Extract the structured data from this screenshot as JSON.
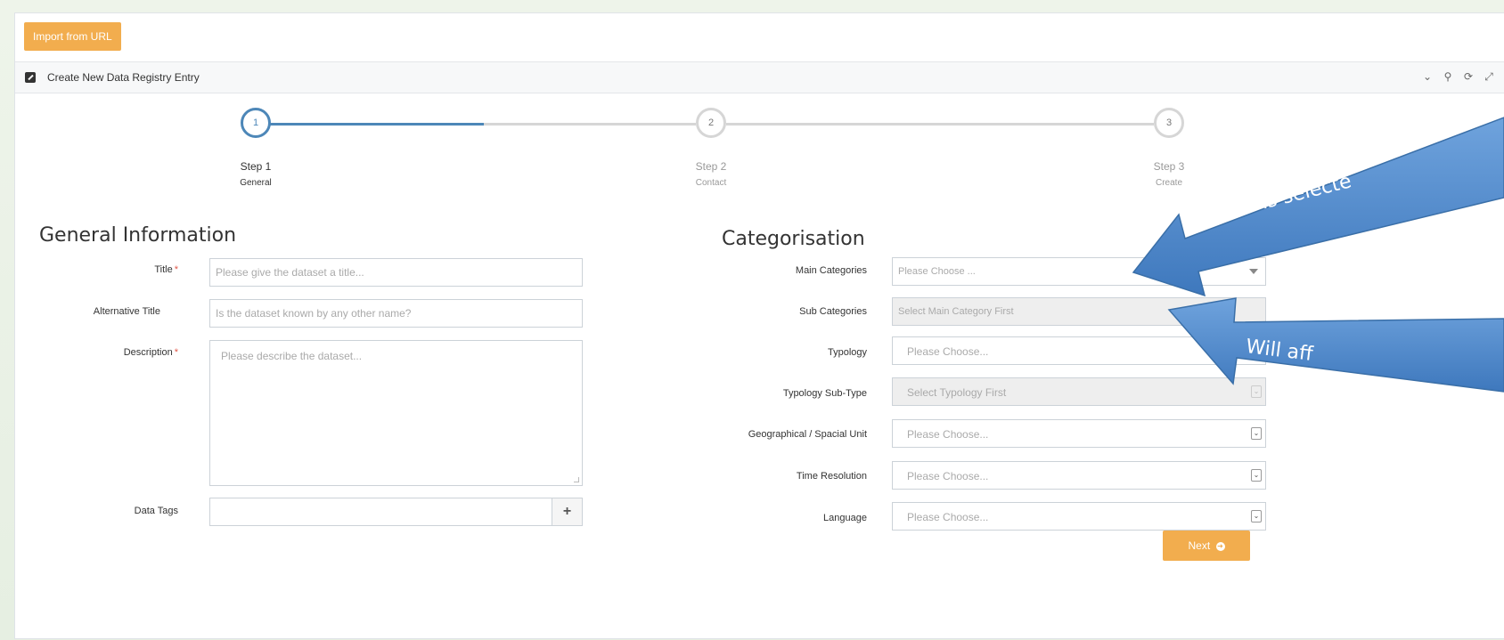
{
  "toolbar": {
    "import_label": "Import from URL"
  },
  "panel": {
    "title": "Create New Data Registry Entry",
    "tools": [
      "⌄",
      "⚲",
      "⟳",
      "⤢",
      "✕"
    ]
  },
  "wizard": {
    "steps": [
      {
        "num": "1",
        "label": "Step 1",
        "sub": "General",
        "active": true
      },
      {
        "num": "2",
        "label": "Step 2",
        "sub": "Contact",
        "active": false
      },
      {
        "num": "3",
        "label": "Step 3",
        "sub": "Create",
        "active": false
      }
    ]
  },
  "general": {
    "heading": "General Information",
    "title_label": "Title",
    "title_placeholder": "Please give the dataset a title...",
    "alt_title_label": "Alternative Title",
    "alt_title_placeholder": "Is the dataset known by any other name?",
    "description_label": "Description",
    "description_placeholder": "Please describe the dataset...",
    "tags_label": "Data Tags",
    "tags_value": "",
    "required_mark": "*"
  },
  "categorisation": {
    "heading": "Categorisation",
    "fields": [
      {
        "label": "Main Categories",
        "value": "Please Choose ...",
        "disabled": false
      },
      {
        "label": "Sub Categories",
        "value": "Select Main Category First",
        "disabled": true
      },
      {
        "label": "Typology",
        "value": "Please Choose...",
        "disabled": false
      },
      {
        "label": "Typology Sub-Type",
        "value": "Select Typology First",
        "disabled": true
      },
      {
        "label": "Geographical / Spacial Unit",
        "value": "Please Choose...",
        "disabled": false
      },
      {
        "label": "Time Resolution",
        "value": "Please Choose...",
        "disabled": false
      },
      {
        "label": "Language",
        "value": "Please Choose...",
        "disabled": false
      }
    ],
    "next_label": "Next"
  },
  "annotations": [
    {
      "text": "What is selecte"
    },
    {
      "text": "Will aff"
    }
  ],
  "colors": {
    "accent": "#f2ad4e",
    "step_active": "#4d87b8",
    "annotation": "#4a86c8"
  }
}
